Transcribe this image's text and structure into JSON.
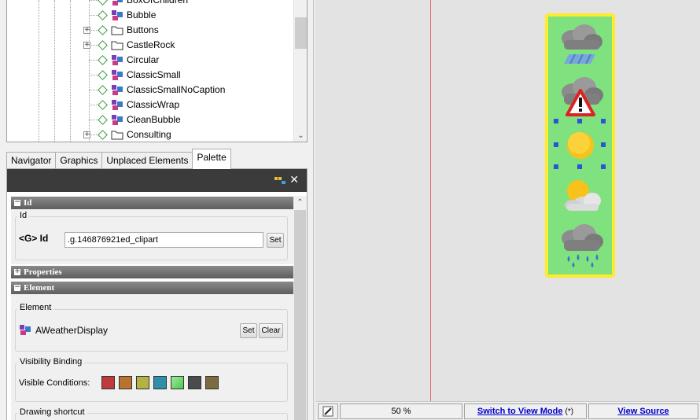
{
  "tree": {
    "items": [
      {
        "label": "BoxOfChildren",
        "kind": "object",
        "expandable": false
      },
      {
        "label": "Bubble",
        "kind": "object",
        "expandable": false
      },
      {
        "label": "Buttons",
        "kind": "folder",
        "expandable": true
      },
      {
        "label": "CastleRock",
        "kind": "folder",
        "expandable": true
      },
      {
        "label": "Circular",
        "kind": "object",
        "expandable": false
      },
      {
        "label": "ClassicSmall",
        "kind": "object",
        "expandable": false
      },
      {
        "label": "ClassicSmallNoCaption",
        "kind": "object",
        "expandable": false
      },
      {
        "label": "ClassicWrap",
        "kind": "object",
        "expandable": false
      },
      {
        "label": "CleanBubble",
        "kind": "object",
        "expandable": false
      },
      {
        "label": "Consulting",
        "kind": "folder",
        "expandable": true
      }
    ]
  },
  "tabs": [
    {
      "label": "Navigator",
      "active": false
    },
    {
      "label": "Graphics",
      "active": false
    },
    {
      "label": "Unplaced Elements",
      "active": false
    },
    {
      "label": "Palette",
      "active": true
    }
  ],
  "palette": {
    "close_glyph": "✕",
    "id_section": {
      "header": "Id",
      "group_label": "Id",
      "prefix": "<G> Id",
      "value": ".g.146876921ed_clipart",
      "set_label": "Set"
    },
    "properties_section": {
      "header": "Properties"
    },
    "element_section": {
      "header": "Element",
      "group_label": "Element",
      "element_name": "AWeatherDisplay",
      "set_label": "Set",
      "clear_label": "Clear"
    },
    "visibility": {
      "group_label": "Visibility Binding",
      "label": "Visible Conditions:",
      "swatches": [
        "#c0393b",
        "#b8742e",
        "#b5b244",
        "#2f8fa8",
        "#4cc94c",
        "#4b4b4b",
        "#7d6a3f"
      ]
    },
    "drawing": {
      "group_label": "Drawing shortcut"
    }
  },
  "canvas": {
    "weather_icons": [
      "cloud-rain-icon",
      "cloud-warning-icon",
      "sun-icon",
      "sun-cloud-icon",
      "cloud-drizzle-icon"
    ],
    "panel_color": "#7fe27f",
    "border_color": "#ffeb2a"
  },
  "statusbar": {
    "zoom": "50 %",
    "switch_mode": "Switch to View Mode",
    "switch_mode_suffix": "(*)",
    "view_source": "View Source"
  }
}
